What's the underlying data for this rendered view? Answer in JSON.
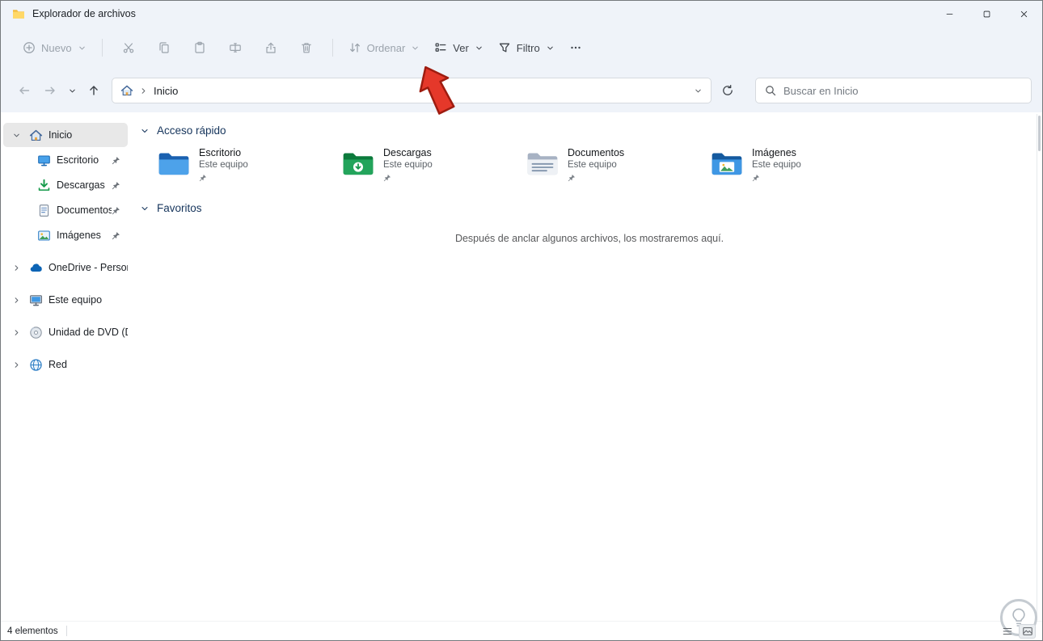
{
  "window": {
    "title": "Explorador de archivos"
  },
  "toolbar": {
    "new_label": "Nuevo",
    "sort_label": "Ordenar",
    "view_label": "Ver",
    "filter_label": "Filtro"
  },
  "navigation": {
    "address": {
      "root": "Inicio"
    },
    "search_placeholder": "Buscar en Inicio"
  },
  "sidebar": {
    "items": [
      {
        "label": "Inicio",
        "selected": true,
        "pinned": false
      },
      {
        "label": "Escritorio",
        "pinned": true
      },
      {
        "label": "Descargas",
        "pinned": true
      },
      {
        "label": "Documentos",
        "pinned": true
      },
      {
        "label": "Imágenes",
        "pinned": true
      },
      {
        "label": "OneDrive - Personal",
        "pinned": false
      },
      {
        "label": "Este equipo",
        "pinned": false
      },
      {
        "label": "Unidad de DVD (D:)",
        "pinned": false
      },
      {
        "label": "Red",
        "pinned": false
      }
    ]
  },
  "content": {
    "sections": {
      "quick_access": "Acceso rápido",
      "favorites": "Favoritos"
    },
    "quick_access_items": [
      {
        "name": "Escritorio",
        "location": "Este equipo"
      },
      {
        "name": "Descargas",
        "location": "Este equipo"
      },
      {
        "name": "Documentos",
        "location": "Este equipo"
      },
      {
        "name": "Imágenes",
        "location": "Este equipo"
      }
    ],
    "favorites_empty_text": "Después de anclar algunos archivos, los mostraremos aquí."
  },
  "statusbar": {
    "items_count": "4 elementos"
  },
  "annotation": {
    "type": "red-arrow",
    "points_at": "Ver",
    "color": "#e5382a"
  },
  "colors": {
    "chrome_bg": "#eff3f9",
    "selection_bg": "#e8e8e8",
    "section_header_text": "#16355c",
    "disabled_icon": "#9ba3ac",
    "arrow_red": "#e5382a"
  },
  "icons": {
    "app-folder-icon": "yellow folder",
    "minimize-icon": "horizontal line",
    "maximize-icon": "square outline",
    "close-icon": "x cross",
    "new-icon": "plus in circle",
    "cut-icon": "scissors",
    "copy-icon": "two pages",
    "paste-icon": "clipboard",
    "rename-icon": "box with text cursor",
    "share-icon": "arrow out of tray",
    "delete-icon": "trash can",
    "sort-icon": "up and down arrows",
    "view-icon": "list with squares",
    "filter-icon": "funnel",
    "more-icon": "three dots",
    "back-icon": "left arrow",
    "forward-icon": "right arrow",
    "recent-locations-icon": "chevron down",
    "up-icon": "up arrow",
    "home-icon": "house",
    "refresh-icon": "circular arrow",
    "search-icon": "magnifier",
    "chevron-down-icon": "chevron down",
    "chevron-right-icon": "chevron right",
    "pin-icon": "pushpin",
    "desktop-icon": "blue monitor",
    "downloads-icon": "green down arrow",
    "documents-icon": "page with lines",
    "pictures-icon": "landscape photo",
    "onedrive-icon": "blue cloud",
    "this-pc-icon": "computer monitor",
    "dvd-icon": "optical disc",
    "network-icon": "globe",
    "folder-desktop-icon": "blue folder",
    "folder-downloads-icon": "green folder with down arrow",
    "folder-documents-icon": "gray folder with lines",
    "folder-pictures-icon": "blue folder with photo",
    "details-view-icon": "list lines",
    "icons-view-icon": "thumbnail frame",
    "lightbulb-icon": "light bulb in circle"
  }
}
